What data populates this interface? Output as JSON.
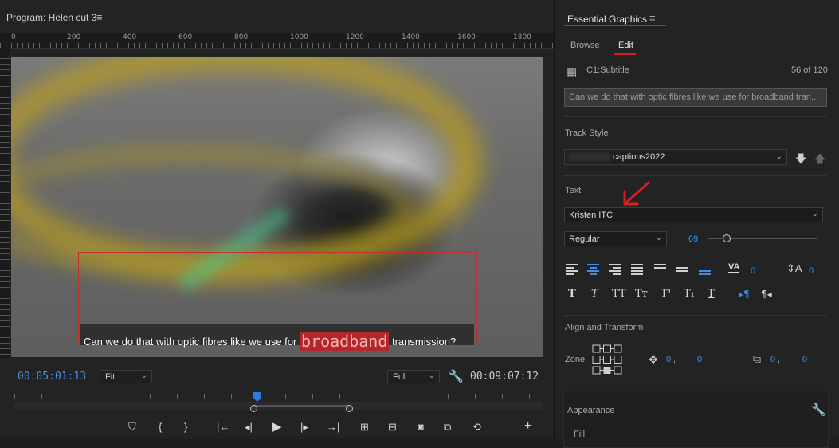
{
  "program_monitor": {
    "title": "Program: Helen cut 3",
    "menu_icon": "hamburger-menu-icon",
    "ruler_labels": [
      "0",
      "200",
      "400",
      "600",
      "800",
      "1000",
      "1200",
      "1400",
      "1600",
      "1800"
    ],
    "subtitle": {
      "before": "Can we do that with optic fibres like we use for",
      "highlight": "broadband",
      "after": "transmission?"
    },
    "timecode_current": "00:05:01:13",
    "timecode_duration": "00:09:07:12",
    "zoom_select": "Fit",
    "resolution_select": "Full",
    "transport_icons": [
      "marker-icon",
      "mark-in-icon",
      "mark-out-icon",
      "go-to-in-icon",
      "step-back-icon",
      "play-icon",
      "step-forward-icon",
      "go-to-out-icon",
      "lift-icon",
      "extract-icon",
      "export-frame-icon",
      "comparison-view-icon",
      "proxy-toggle-icon",
      "add-button-icon"
    ]
  },
  "essential_graphics": {
    "title": "Essential Graphics",
    "tabs": {
      "browse": "Browse",
      "edit": "Edit"
    },
    "clip_name": "C1:Subtitle",
    "clip_count": "56 of 120",
    "caption_text": "Can we do that with optic fibres like we use for broadband tran...",
    "track_style_label": "Track Style",
    "track_style_value": "captions2022",
    "text_label": "Text",
    "font": "Kristen ITC",
    "weight": "Regular",
    "font_size": "69",
    "tracking_value": "0",
    "leading_value": "0",
    "align_transform_label": "Align and Transform",
    "zone_label": "Zone",
    "position_x": "0",
    "position_y": "0",
    "size_x": "0",
    "size_y": "0",
    "separator": ",",
    "appearance_label": "Appearance",
    "fill_label": "Fill",
    "style_buttons": [
      "T",
      "T",
      "TT",
      "Tт",
      "T¹",
      "T₁",
      "T"
    ],
    "annotation_color": "#d81e1e",
    "accent_color": "#3d8ee8"
  }
}
